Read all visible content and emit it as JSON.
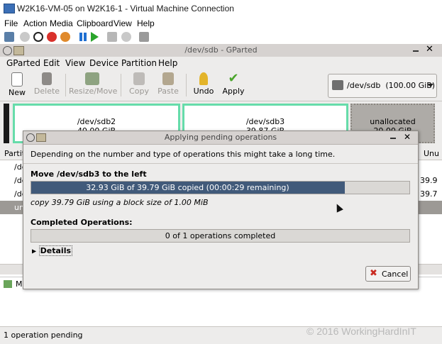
{
  "vm_window": {
    "title": "W2K16-VM-05 on W2K16-1 - Virtual Machine Connection",
    "menu": [
      "File",
      "Action",
      "Media",
      "Clipboard",
      "View",
      "Help"
    ]
  },
  "gparted": {
    "title": "/dev/sdb - GParted",
    "menu": [
      "GParted",
      "Edit",
      "View",
      "Device",
      "Partition",
      "Help"
    ],
    "toolbar": {
      "new": "New",
      "delete": "Delete",
      "resize_move": "Resize/Move",
      "copy": "Copy",
      "paste": "Paste",
      "undo": "Undo",
      "apply": "Apply"
    },
    "device_selector": "/dev/sdb  (100.00 GiB)",
    "partitions": [
      {
        "name": "/dev/sdb2",
        "size": "40.00 GiB"
      },
      {
        "name": "/dev/sdb3",
        "size": "39.87 GiB"
      },
      {
        "name": "unallocated",
        "size": "20.00 GiB"
      }
    ],
    "list": {
      "header_left": "Partiti",
      "header_right": "Unu",
      "rows": [
        {
          "left": "/de",
          "right": ""
        },
        {
          "left": "/de",
          "right": "39.9"
        },
        {
          "left": "/de",
          "right": "39.7"
        },
        {
          "left": "un",
          "right": ""
        }
      ]
    },
    "pending_left": "M",
    "status": "1 operation pending"
  },
  "dialog": {
    "title": "Applying pending operations",
    "message": "Depending on the number and type of operations this might take a long time.",
    "operation_title": "Move /dev/sdb3 to the left",
    "progress_text": "32.93 GiB of 39.79 GiB copied (00:00:29 remaining)",
    "progress_fraction": 0.83,
    "sub_text": "copy 39.79 GiB using a block size of 1.00 MiB",
    "completed_heading": "Completed Operations:",
    "completed_text": "0 of 1 operations completed",
    "details_label": "Details",
    "cancel_label": "Cancel"
  },
  "watermark": "© 2016 WorkingHardInIT",
  "colors": {
    "progress_fill": "#415a7a",
    "partition_border": "#66dcaa",
    "apply_green": "#4aa52b"
  }
}
